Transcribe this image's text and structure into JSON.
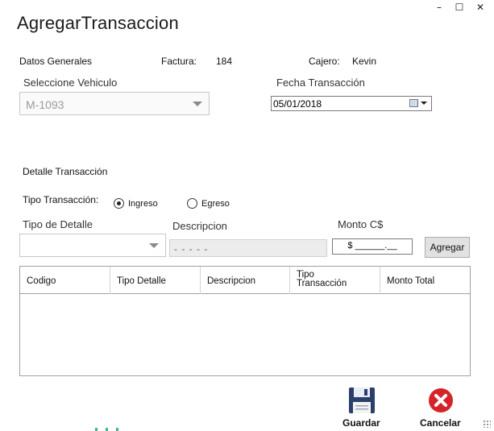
{
  "window": {
    "title": "AgregarTransaccion",
    "controls": {
      "minimize": "–",
      "maximize": "☐",
      "close": "✕"
    }
  },
  "header": {
    "section_label": "Datos Generales",
    "factura_label": "Factura:",
    "factura_value": "184",
    "cajero_label": "Cajero:",
    "cajero_value": "Kevin"
  },
  "vehiculo": {
    "label": "Seleccione Vehiculo",
    "value": "M-1093"
  },
  "fecha": {
    "label": "Fecha Transacción",
    "value": "05/01/2018"
  },
  "detalle": {
    "section_label": "Detalle Transacción",
    "tipo_transaccion_label": "Tipo Transacción:",
    "radio_ingreso": "Ingreso",
    "radio_egreso": "Egreso",
    "selected": "Ingreso",
    "tipo_detalle_label": "Tipo de Detalle",
    "tipo_detalle_value": "",
    "descripcion_label": "Descripcion",
    "descripcion_value": "- - - - -",
    "monto_label": "Monto C$",
    "monto_value": "$ ______.__",
    "agregar_label": "Agregar"
  },
  "grid": {
    "columns": [
      "Codigo",
      "Tipo Detalle",
      "Descripcion",
      "Tipo Transacción",
      "Monto Total"
    ],
    "rows": []
  },
  "actions": {
    "guardar_label": "Guardar",
    "cancelar_label": "Cancelar"
  },
  "colors": {
    "save_icon": "#2b3f6b",
    "cancel_icon": "#d6232a",
    "grid_border": "#a0a0a0"
  }
}
